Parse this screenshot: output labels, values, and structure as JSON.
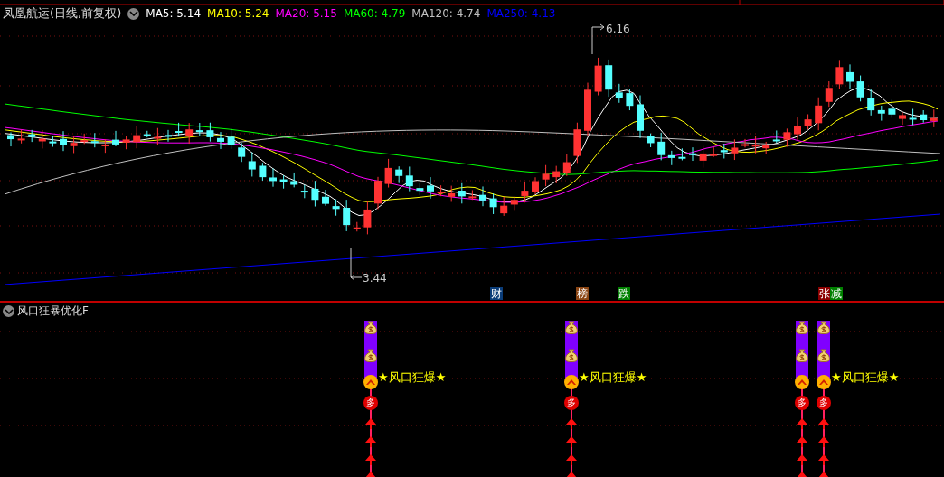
{
  "header": {
    "title": "凤凰航运(日线,前复权)",
    "ma": [
      {
        "label": "MA5: 5.14",
        "color": "#ffffff"
      },
      {
        "label": "MA10: 5.24",
        "color": "#ffff00"
      },
      {
        "label": "MA20: 5.15",
        "color": "#ff00ff"
      },
      {
        "label": "MA60: 4.79",
        "color": "#00ff00"
      },
      {
        "label": "MA120: 4.74",
        "color": "#c0c0c0"
      },
      {
        "label": "MA250: 4.13",
        "color": "#0000ff"
      }
    ]
  },
  "price_labels": {
    "high": "6.16",
    "low": "3.44"
  },
  "event_tags": [
    {
      "text": "财",
      "color": "#0a3c78"
    },
    {
      "text": "榜",
      "color": "#8b4513"
    },
    {
      "text": "跌",
      "color": "#008000"
    },
    {
      "text": "张",
      "color": "#8b0000"
    },
    {
      "text": "减",
      "color": "#008000"
    }
  ],
  "indicator": {
    "title": "风口狂暴优化F",
    "signals": [
      {
        "tag": "多",
        "label": "★风口狂爆★"
      },
      {
        "tag": "多",
        "label": "★风口狂爆★"
      },
      {
        "tag": "多"
      },
      {
        "tag": "多",
        "label": "★风口狂爆★"
      }
    ]
  }
}
